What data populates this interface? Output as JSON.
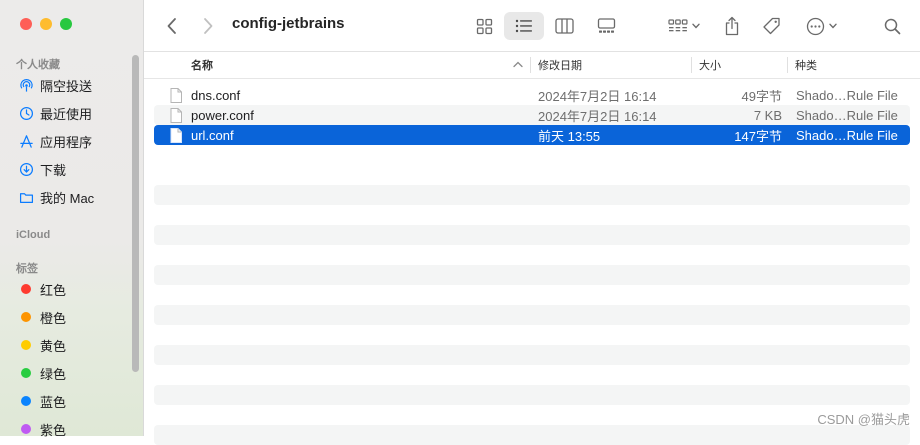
{
  "window": {
    "title": "config-jetbrains"
  },
  "sidebar": {
    "favorites_title": "个人收藏",
    "favorites": [
      {
        "label": "隔空投送",
        "icon": "airdrop-icon"
      },
      {
        "label": "最近使用",
        "icon": "clock-icon"
      },
      {
        "label": "应用程序",
        "icon": "applications-icon"
      },
      {
        "label": "下载",
        "icon": "download-icon"
      },
      {
        "label": "我的 Mac",
        "icon": "folder-icon"
      }
    ],
    "icloud_title": "iCloud",
    "tags_title": "标签",
    "tags": [
      {
        "label": "红色",
        "color": "#fe3b30"
      },
      {
        "label": "橙色",
        "color": "#fd9400"
      },
      {
        "label": "黄色",
        "color": "#ffcc00"
      },
      {
        "label": "绿色",
        "color": "#28cd41"
      },
      {
        "label": "蓝色",
        "color": "#0b84fe"
      },
      {
        "label": "紫色",
        "color": "#bf5af2"
      }
    ]
  },
  "columns": {
    "name": "名称",
    "modified": "修改日期",
    "size": "大小",
    "kind": "种类"
  },
  "files": [
    {
      "name": "dns.conf",
      "modified": "2024年7月2日 16:14",
      "size": "49字节",
      "kind": "Shado…Rule File",
      "selected": false
    },
    {
      "name": "power.conf",
      "modified": "2024年7月2日 16:14",
      "size": "7 KB",
      "kind": "Shado…Rule File",
      "selected": false
    },
    {
      "name": "url.conf",
      "modified": "前天 13:55",
      "size": "147字节",
      "kind": "Shado…Rule File",
      "selected": true
    }
  ],
  "watermark": "CSDN @猫头虎",
  "colors": {
    "accent": "#0a64d9",
    "stripe": "#f4f5f5"
  }
}
